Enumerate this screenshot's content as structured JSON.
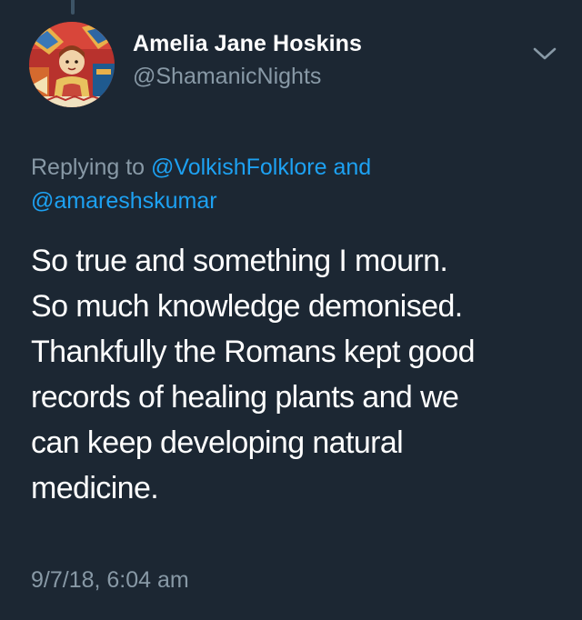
{
  "tweet": {
    "author_name": "Amelia Jane Hoskins",
    "author_handle": "@ShamanicNights",
    "reply_prefix": "Replying to ",
    "reply_mention_1": "@VolkishFolklore",
    "reply_joiner": " and",
    "reply_mention_2": "@amareshskumar",
    "text_lines": [
      "So true and something I mourn.",
      "So much knowledge demonised.",
      "Thankfully the Romans kept good",
      "records of healing plants and we",
      "can keep developing natural",
      "medicine."
    ],
    "timestamp": "9/7/18, 6:04 am"
  },
  "icons": {
    "menu": "chevron-down-icon",
    "avatar": "profile-avatar"
  },
  "colors": {
    "background": "#1c2733",
    "primary_text": "#ffffff",
    "secondary_text": "#8899a6",
    "link": "#1da1f2"
  }
}
